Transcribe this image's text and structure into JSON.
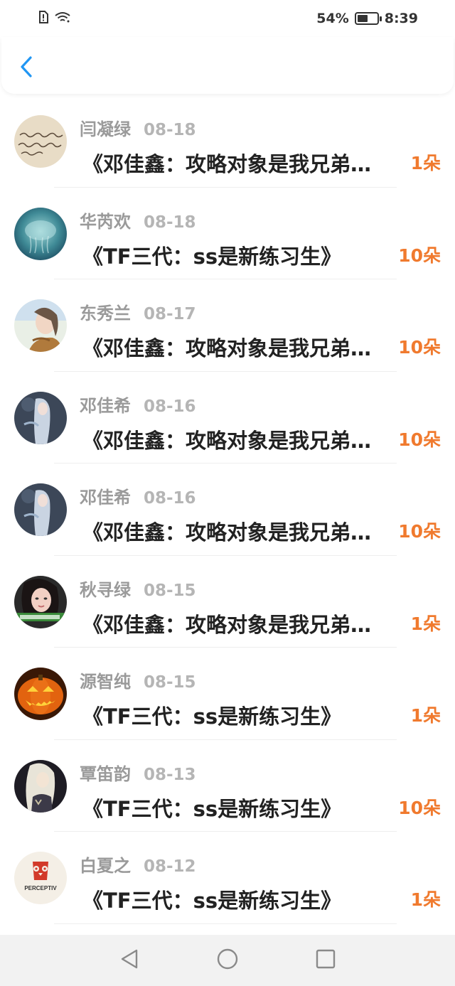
{
  "status_bar": {
    "battery_percent": "54%",
    "battery_level": 0.54,
    "time": "8:39"
  },
  "header": {
    "back_icon": "chevron-left-icon",
    "accent_color": "#2196F3"
  },
  "list": {
    "accent_color": "#F07A2E",
    "rows": [
      {
        "name": "闫凝绿",
        "date": "08-18",
        "title": "《邓佳鑫：攻略对象是我兄弟…",
        "count": "1朵",
        "avatar": "handwriting-avatar"
      },
      {
        "name": "华芮欢",
        "date": "08-18",
        "title": "《TF三代：ss是新练习生》",
        "count": "10朵",
        "avatar": "jellyfish-avatar"
      },
      {
        "name": "东秀兰",
        "date": "08-17",
        "title": "《邓佳鑫：攻略对象是我兄弟…",
        "count": "10朵",
        "avatar": "girl-portrait-avatar"
      },
      {
        "name": "邓佳希",
        "date": "08-16",
        "title": "《邓佳鑫：攻略对象是我兄弟…",
        "count": "10朵",
        "avatar": "anime-girl-avatar"
      },
      {
        "name": "邓佳希",
        "date": "08-16",
        "title": "《邓佳鑫：攻略对象是我兄弟…",
        "count": "10朵",
        "avatar": "anime-girl-avatar"
      },
      {
        "name": "秋寻绿",
        "date": "08-15",
        "title": "《邓佳鑫：攻略对象是我兄弟…",
        "count": "1朵",
        "avatar": "woman-selfie-avatar"
      },
      {
        "name": "源智纯",
        "date": "08-15",
        "title": "《TF三代：ss是新练习生》",
        "count": "1朵",
        "avatar": "pumpkin-avatar"
      },
      {
        "name": "覃笛韵",
        "date": "08-13",
        "title": "《TF三代：ss是新练习生》",
        "count": "10朵",
        "avatar": "anime-character-avatar"
      },
      {
        "name": "白夏之",
        "date": "08-12",
        "title": "《TF三代：ss是新练习生》",
        "count": "1朵",
        "avatar": "owl-logo-avatar",
        "logo_text": "PERCEPTIV"
      }
    ]
  },
  "nav_bar": {
    "buttons": [
      "back-triangle-icon",
      "home-circle-icon",
      "recents-square-icon"
    ]
  }
}
